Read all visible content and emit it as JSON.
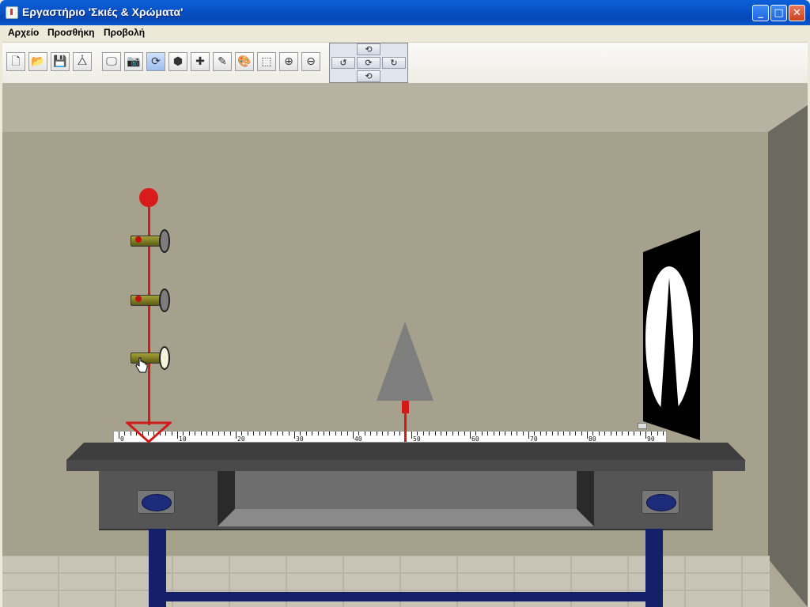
{
  "window": {
    "title": "Εργαστήριο 'Σκιές & Χρώματα'",
    "controls": {
      "minimize": "_",
      "maximize": "□",
      "close": "✕"
    }
  },
  "menubar": {
    "items": [
      "Αρχείο",
      "Προσθήκη",
      "Προβολή"
    ]
  },
  "toolbar": {
    "tools": [
      {
        "icon": "new-file-icon",
        "glyph": "🗋"
      },
      {
        "icon": "open-folder-icon",
        "glyph": "📂"
      },
      {
        "icon": "save-icon",
        "glyph": "💾"
      },
      {
        "icon": "properties-icon",
        "glyph": "⧊"
      },
      {
        "icon": "monitor-view-icon",
        "glyph": "🖵"
      },
      {
        "icon": "camera-icon",
        "glyph": "📷"
      },
      {
        "icon": "rotate-scene-icon",
        "glyph": "⟳",
        "active": true
      },
      {
        "icon": "3d-box-icon",
        "glyph": "⬢"
      },
      {
        "icon": "add-icon",
        "glyph": "✚"
      },
      {
        "icon": "pencil-icon",
        "glyph": "✎"
      },
      {
        "icon": "palette-icon",
        "glyph": "🎨"
      },
      {
        "icon": "select-frame-icon",
        "glyph": "⬚"
      },
      {
        "icon": "zoom-in-icon",
        "glyph": "⊕"
      },
      {
        "icon": "zoom-out-icon",
        "glyph": "⊖"
      }
    ],
    "navigation": {
      "up": "⟲",
      "left": "↺",
      "center": "⟳",
      "right": "↻",
      "down": "⟲"
    }
  },
  "scene": {
    "ruler_labels": [
      "0",
      "10",
      "20",
      "30",
      "40",
      "50",
      "60",
      "70",
      "80",
      "90"
    ],
    "lamps": [
      {
        "state": "off"
      },
      {
        "state": "off"
      },
      {
        "state": "on"
      }
    ],
    "colors": {
      "stand": "#d31a1a",
      "table": "#3e3e3e",
      "legs": "#14206a",
      "wall": "#a6a18d"
    }
  }
}
